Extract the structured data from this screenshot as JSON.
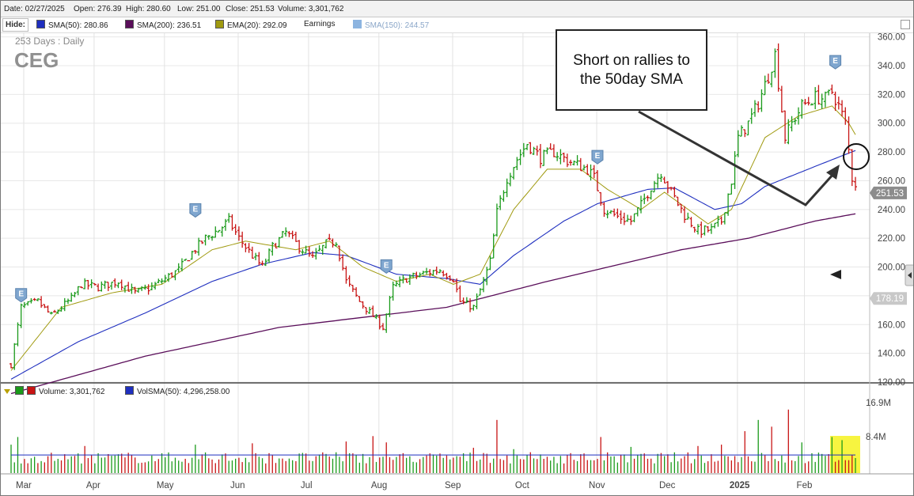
{
  "header": {
    "date": "Date: 02/27/2025",
    "open": "Open: 276.39",
    "high": "High: 280.60",
    "low": "Low: 251.00",
    "close": "Close: 251.53",
    "volume": "Volume: 3,301,762"
  },
  "legend": {
    "hide": "Hide:",
    "sma50": "SMA(50): 280.86",
    "sma200": "SMA(200): 236.51",
    "ema20": "EMA(20): 292.09",
    "earnings": "Earnings",
    "sma150": "SMA(150): 244.57"
  },
  "volume_legend": {
    "volume": "Volume: 3,301,762",
    "volsma": "VolSMA(50): 4,296,258.00"
  },
  "colors": {
    "sma50": "#1f2fbf",
    "sma200": "#5a0e5a",
    "ema20": "#a09a10",
    "sma150": "#8cb4e0",
    "up": "#1a9a1a",
    "down": "#c81414",
    "highlight": "#f4f000"
  },
  "chart_data": {
    "type": "ohlc",
    "period_label": "253 Days : Daily",
    "symbol": "CEG",
    "y_ticks": [
      "120.00",
      "140.00",
      "160.00",
      "180.00",
      "200.00",
      "220.00",
      "240.00",
      "260.00",
      "280.00",
      "300.00",
      "320.00",
      "340.00",
      "360.00"
    ],
    "y_range": [
      120,
      362
    ],
    "last_price_label": "251.53",
    "marker_label": "178.19",
    "x_labels": [
      "Mar",
      "Apr",
      "May",
      "Jun",
      "Jul",
      "Aug",
      "Sep",
      "Oct",
      "Nov",
      "Dec",
      "2025",
      "Feb"
    ],
    "earnings_marker": "E",
    "earnings_points": [
      {
        "day": 3,
        "price": 168
      },
      {
        "day": 55,
        "price": 227
      },
      {
        "day": 112,
        "price": 188
      },
      {
        "day": 175,
        "price": 264
      },
      {
        "day": 246,
        "price": 330
      }
    ],
    "price_anchors": [
      [
        0,
        132
      ],
      [
        3,
        172
      ],
      [
        8,
        176
      ],
      [
        12,
        166
      ],
      [
        18,
        178
      ],
      [
        21,
        188
      ],
      [
        26,
        186
      ],
      [
        32,
        190
      ],
      [
        37,
        182
      ],
      [
        42,
        186
      ],
      [
        46,
        192
      ],
      [
        50,
        198
      ],
      [
        54,
        210
      ],
      [
        58,
        220
      ],
      [
        62,
        226
      ],
      [
        65,
        232
      ],
      [
        68,
        220
      ],
      [
        72,
        208
      ],
      [
        75,
        200
      ],
      [
        78,
        214
      ],
      [
        82,
        224
      ],
      [
        86,
        214
      ],
      [
        90,
        206
      ],
      [
        94,
        216
      ],
      [
        97,
        218
      ],
      [
        100,
        190
      ],
      [
        104,
        176
      ],
      [
        108,
        166
      ],
      [
        111,
        158
      ],
      [
        114,
        186
      ],
      [
        118,
        192
      ],
      [
        124,
        196
      ],
      [
        128,
        198
      ],
      [
        132,
        192
      ],
      [
        134,
        176
      ],
      [
        138,
        172
      ],
      [
        141,
        190
      ],
      [
        143,
        204
      ],
      [
        145,
        238
      ],
      [
        148,
        262
      ],
      [
        151,
        275
      ],
      [
        154,
        286
      ],
      [
        158,
        276
      ],
      [
        162,
        280
      ],
      [
        166,
        274
      ],
      [
        172,
        268
      ],
      [
        174,
        262
      ],
      [
        177,
        240
      ],
      [
        181,
        235
      ],
      [
        185,
        232
      ],
      [
        188,
        243
      ],
      [
        191,
        256
      ],
      [
        194,
        266
      ],
      [
        197,
        252
      ],
      [
        201,
        236
      ],
      [
        205,
        225
      ],
      [
        209,
        226
      ],
      [
        212,
        232
      ],
      [
        215,
        260
      ],
      [
        217,
        290
      ],
      [
        220,
        300
      ],
      [
        223,
        314
      ],
      [
        226,
        333
      ],
      [
        228,
        348
      ],
      [
        231,
        290
      ],
      [
        233,
        300
      ],
      [
        236,
        312
      ],
      [
        240,
        318
      ],
      [
        243,
        317
      ],
      [
        245,
        322
      ],
      [
        247,
        312
      ],
      [
        249,
        300
      ],
      [
        251,
        262
      ],
      [
        252,
        258
      ]
    ],
    "ema20_anchors": [
      [
        0,
        128
      ],
      [
        15,
        172
      ],
      [
        30,
        182
      ],
      [
        45,
        188
      ],
      [
        60,
        212
      ],
      [
        70,
        218
      ],
      [
        85,
        212
      ],
      [
        95,
        218
      ],
      [
        105,
        200
      ],
      [
        115,
        190
      ],
      [
        125,
        195
      ],
      [
        132,
        188
      ],
      [
        140,
        195
      ],
      [
        150,
        240
      ],
      [
        160,
        268
      ],
      [
        170,
        268
      ],
      [
        178,
        254
      ],
      [
        188,
        240
      ],
      [
        195,
        252
      ],
      [
        208,
        230
      ],
      [
        215,
        240
      ],
      [
        225,
        290
      ],
      [
        235,
        305
      ],
      [
        245,
        312
      ],
      [
        250,
        300
      ],
      [
        252,
        292
      ]
    ],
    "sma50_anchors": [
      [
        0,
        122
      ],
      [
        20,
        148
      ],
      [
        40,
        168
      ],
      [
        60,
        190
      ],
      [
        75,
        202
      ],
      [
        90,
        210
      ],
      [
        100,
        208
      ],
      [
        115,
        195
      ],
      [
        130,
        192
      ],
      [
        140,
        188
      ],
      [
        150,
        208
      ],
      [
        165,
        232
      ],
      [
        175,
        244
      ],
      [
        190,
        254
      ],
      [
        198,
        255
      ],
      [
        210,
        240
      ],
      [
        218,
        244
      ],
      [
        225,
        256
      ],
      [
        240,
        270
      ],
      [
        252,
        281
      ]
    ],
    "sma200_anchors": [
      [
        0,
        112
      ],
      [
        40,
        138
      ],
      [
        80,
        158
      ],
      [
        130,
        172
      ],
      [
        160,
        190
      ],
      [
        200,
        212
      ],
      [
        220,
        220
      ],
      [
        240,
        232
      ],
      [
        252,
        237
      ]
    ],
    "volume_scale_labels": [
      "16.9M",
      "8.4M"
    ],
    "volume_max": 16.9,
    "volume_avg": 4.2,
    "volume_spikes": [
      [
        0,
        6.5
      ],
      [
        2,
        8.2
      ],
      [
        22,
        6.2
      ],
      [
        55,
        6.5
      ],
      [
        72,
        6.8
      ],
      [
        100,
        7.2
      ],
      [
        108,
        8.4
      ],
      [
        112,
        7.0
      ],
      [
        138,
        5.8
      ],
      [
        145,
        12.0
      ],
      [
        150,
        5.5
      ],
      [
        176,
        8.2
      ],
      [
        185,
        6.0
      ],
      [
        205,
        6.2
      ],
      [
        212,
        6.5
      ],
      [
        219,
        9.5
      ],
      [
        223,
        12.0
      ],
      [
        227,
        10.5
      ],
      [
        232,
        14.3
      ],
      [
        236,
        7.0
      ],
      [
        245,
        8.2
      ],
      [
        248,
        7.5
      ]
    ]
  },
  "annotation": {
    "line1": "Short on rallies to",
    "line2": "the 50day SMA"
  }
}
